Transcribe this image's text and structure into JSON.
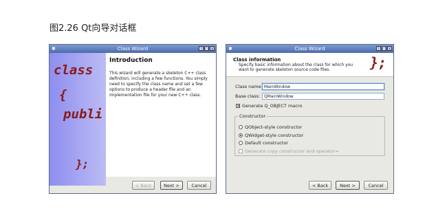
{
  "caption": "图2.26 Qt向导对话框",
  "left_window": {
    "title": "Class Wizard",
    "side_code": [
      "class",
      "{",
      "publi",
      "};"
    ],
    "intro_title": "Introduction",
    "intro_body": "This wizard will generate a skeleton C++ class definition, including a few functions. You simply need to specify the class name and set a few options to produce a header file and an implementation file for your new C++ class.",
    "buttons": {
      "back": "< Back",
      "next": "Next >",
      "cancel": "Cancel"
    }
  },
  "right_window": {
    "title": "Class Wizard",
    "header_title": "Class information",
    "header_desc": "Specify basic information about the class for which you want to generate skeleton source code files.",
    "header_logo": "};",
    "class_name_label": "Class name:",
    "class_name_value": "MainWindow",
    "base_class_label": "Base class:",
    "base_class_value": "QMainWindow",
    "qobject_macro_label": "Generate Q_OBJECT macro",
    "constructor_group": "Constructor",
    "options": [
      "QObject-style constructor",
      "QWidget-style constructor",
      "Default constructor"
    ],
    "selected_option": 1,
    "copy_ctor_label": "Generate copy constructor and operator=",
    "buttons": {
      "back": "< Back",
      "next": "Next >",
      "cancel": "Cancel"
    }
  },
  "titlebar_buttons": [
    "?",
    "□",
    "X"
  ]
}
